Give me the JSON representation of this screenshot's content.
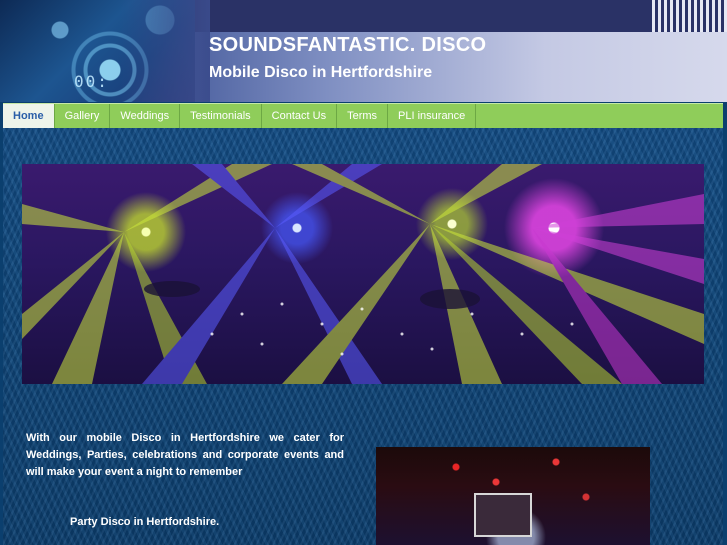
{
  "header": {
    "title": "SOUNDSFANTASTIC. DISCO",
    "tagline": "Mobile Disco in Hertfordshire",
    "art_digits": "00:"
  },
  "nav": {
    "items": [
      {
        "label": "Home",
        "active": true
      },
      {
        "label": "Gallery",
        "active": false
      },
      {
        "label": "Weddings",
        "active": false
      },
      {
        "label": "Testimonials",
        "active": false
      },
      {
        "label": "Contact Us",
        "active": false
      },
      {
        "label": "Terms",
        "active": false
      },
      {
        "label": "PLI insurance",
        "active": false
      }
    ]
  },
  "main": {
    "intro_text": "With our mobile Disco in Hertfordshire we cater for Weddings, Parties, celebrations and corporate events and will make your event a night to remember",
    "subheading": "Party Disco in Hertfordshire."
  },
  "colors": {
    "nav_bg": "#8fcd5a",
    "active_tab_text": "#2a5ea8",
    "header_text": "#ffffff",
    "page_bg": "#0f4576"
  }
}
